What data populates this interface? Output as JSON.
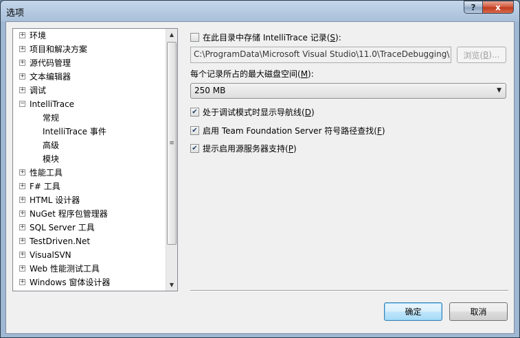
{
  "window": {
    "title": "选项",
    "help_glyph": "?",
    "close_glyph": "x"
  },
  "tree": {
    "items": [
      {
        "label": "环境",
        "level": 0,
        "expander": "+"
      },
      {
        "label": "项目和解决方案",
        "level": 0,
        "expander": "+"
      },
      {
        "label": "源代码管理",
        "level": 0,
        "expander": "+"
      },
      {
        "label": "文本编辑器",
        "level": 0,
        "expander": "+"
      },
      {
        "label": "调试",
        "level": 0,
        "expander": "+"
      },
      {
        "label": "IntelliTrace",
        "level": 0,
        "expander": "−"
      },
      {
        "label": "常规",
        "level": 1,
        "expander": ""
      },
      {
        "label": "IntelliTrace 事件",
        "level": 1,
        "expander": ""
      },
      {
        "label": "高级",
        "level": 1,
        "expander": ""
      },
      {
        "label": "模块",
        "level": 1,
        "expander": ""
      },
      {
        "label": "性能工具",
        "level": 0,
        "expander": "+"
      },
      {
        "label": "F# 工具",
        "level": 0,
        "expander": "+"
      },
      {
        "label": "HTML 设计器",
        "level": 0,
        "expander": "+"
      },
      {
        "label": "NuGet 程序包管理器",
        "level": 0,
        "expander": "+"
      },
      {
        "label": "SQL Server 工具",
        "level": 0,
        "expander": "+"
      },
      {
        "label": "TestDriven.Net",
        "level": 0,
        "expander": "+"
      },
      {
        "label": "VisualSVN",
        "level": 0,
        "expander": "+"
      },
      {
        "label": "Web 性能测试工具",
        "level": 0,
        "expander": "+"
      },
      {
        "label": "Windows 窗体设计器",
        "level": 0,
        "expander": "+"
      }
    ]
  },
  "scrollbar": {
    "up": "▲",
    "down": "▼",
    "grip": "≡"
  },
  "settings": {
    "store_in_dir": {
      "label": "在此目录中存储 IntelliTrace 记录(",
      "key": "S",
      "suffix": "):",
      "checked": false
    },
    "path_value": "C:\\ProgramData\\Microsoft Visual Studio\\11.0\\TraceDebugging\\",
    "browse": {
      "label": "浏览(",
      "key": "B",
      "suffix": ")..."
    },
    "max_disk": {
      "label": "每个记录所占的最大磁盘空间(",
      "key": "M",
      "suffix": "):"
    },
    "max_disk_value": "250 MB",
    "show_nav": {
      "label": "处于调试模式时显示导航线(",
      "key": "D",
      "suffix": ")",
      "checked": true
    },
    "tfs_symbols": {
      "label": "启用 Team Foundation Server 符号路径查找(",
      "key": "F",
      "suffix": ")",
      "checked": true
    },
    "source_server": {
      "label": "提示启用源服务器支持(",
      "key": "P",
      "suffix": ")",
      "checked": true
    },
    "check_glyph": "✔"
  },
  "buttons": {
    "ok": "确定",
    "cancel": "取消"
  }
}
